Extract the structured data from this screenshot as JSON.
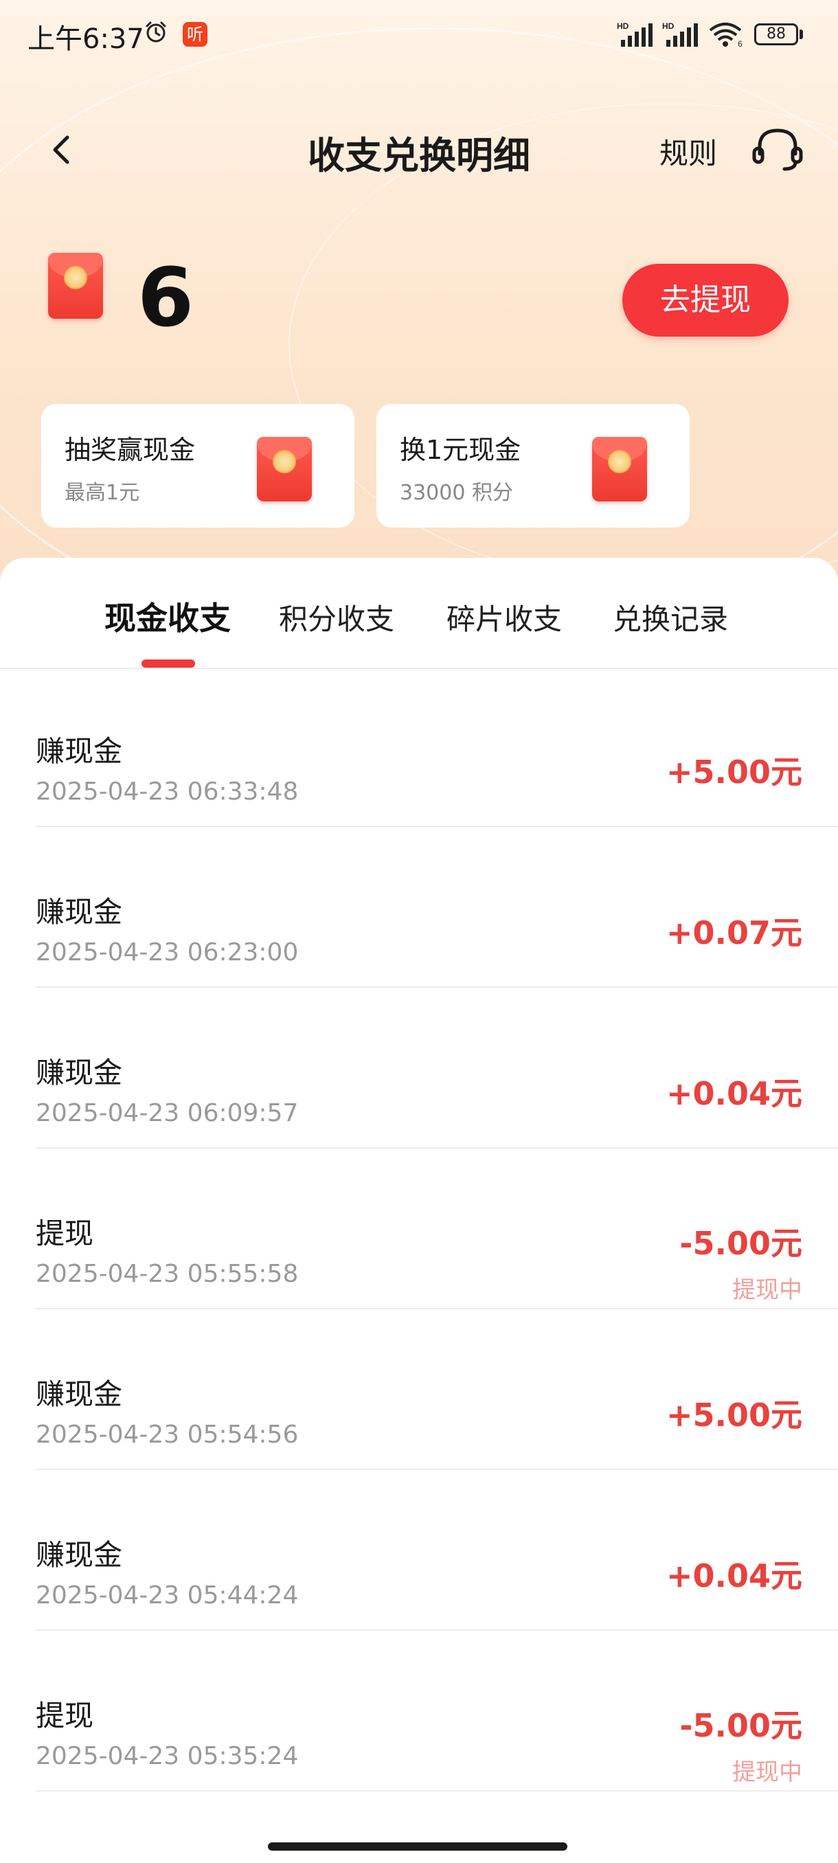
{
  "status_bar": {
    "time": "上午6:37",
    "app_badge": "听",
    "signal1_label": "HD",
    "signal2_label": "HD",
    "wifi_label": "6",
    "battery": "88"
  },
  "header": {
    "title": "收支兑换明细",
    "rules_label": "规则"
  },
  "balance": {
    "amount": "6",
    "withdraw_label": "去提现"
  },
  "promo_cards": [
    {
      "title": "抽奖赢现金",
      "subtitle": "最高1元"
    },
    {
      "title": "换1元现金",
      "subtitle": "33000 积分"
    }
  ],
  "tabs": [
    {
      "label": "现金收支",
      "active": true
    },
    {
      "label": "积分收支",
      "active": false
    },
    {
      "label": "碎片收支",
      "active": false
    },
    {
      "label": "兑换记录",
      "active": false
    }
  ],
  "records": [
    {
      "title": "赚现金",
      "time": "2025-04-23 06:33:48",
      "amount": "+5.00元",
      "status": ""
    },
    {
      "title": "赚现金",
      "time": "2025-04-23 06:23:00",
      "amount": "+0.07元",
      "status": ""
    },
    {
      "title": "赚现金",
      "time": "2025-04-23 06:09:57",
      "amount": "+0.04元",
      "status": ""
    },
    {
      "title": "提现",
      "time": "2025-04-23 05:55:58",
      "amount": "-5.00元",
      "status": "提现中"
    },
    {
      "title": "赚现金",
      "time": "2025-04-23 05:54:56",
      "amount": "+5.00元",
      "status": ""
    },
    {
      "title": "赚现金",
      "time": "2025-04-23 05:44:24",
      "amount": "+0.04元",
      "status": ""
    },
    {
      "title": "提现",
      "time": "2025-04-23 05:35:24",
      "amount": "-5.00元",
      "status": "提现中"
    }
  ],
  "colors": {
    "accent": "#f5363a",
    "amount": "#e8423e",
    "pending": "#f2a09c"
  }
}
